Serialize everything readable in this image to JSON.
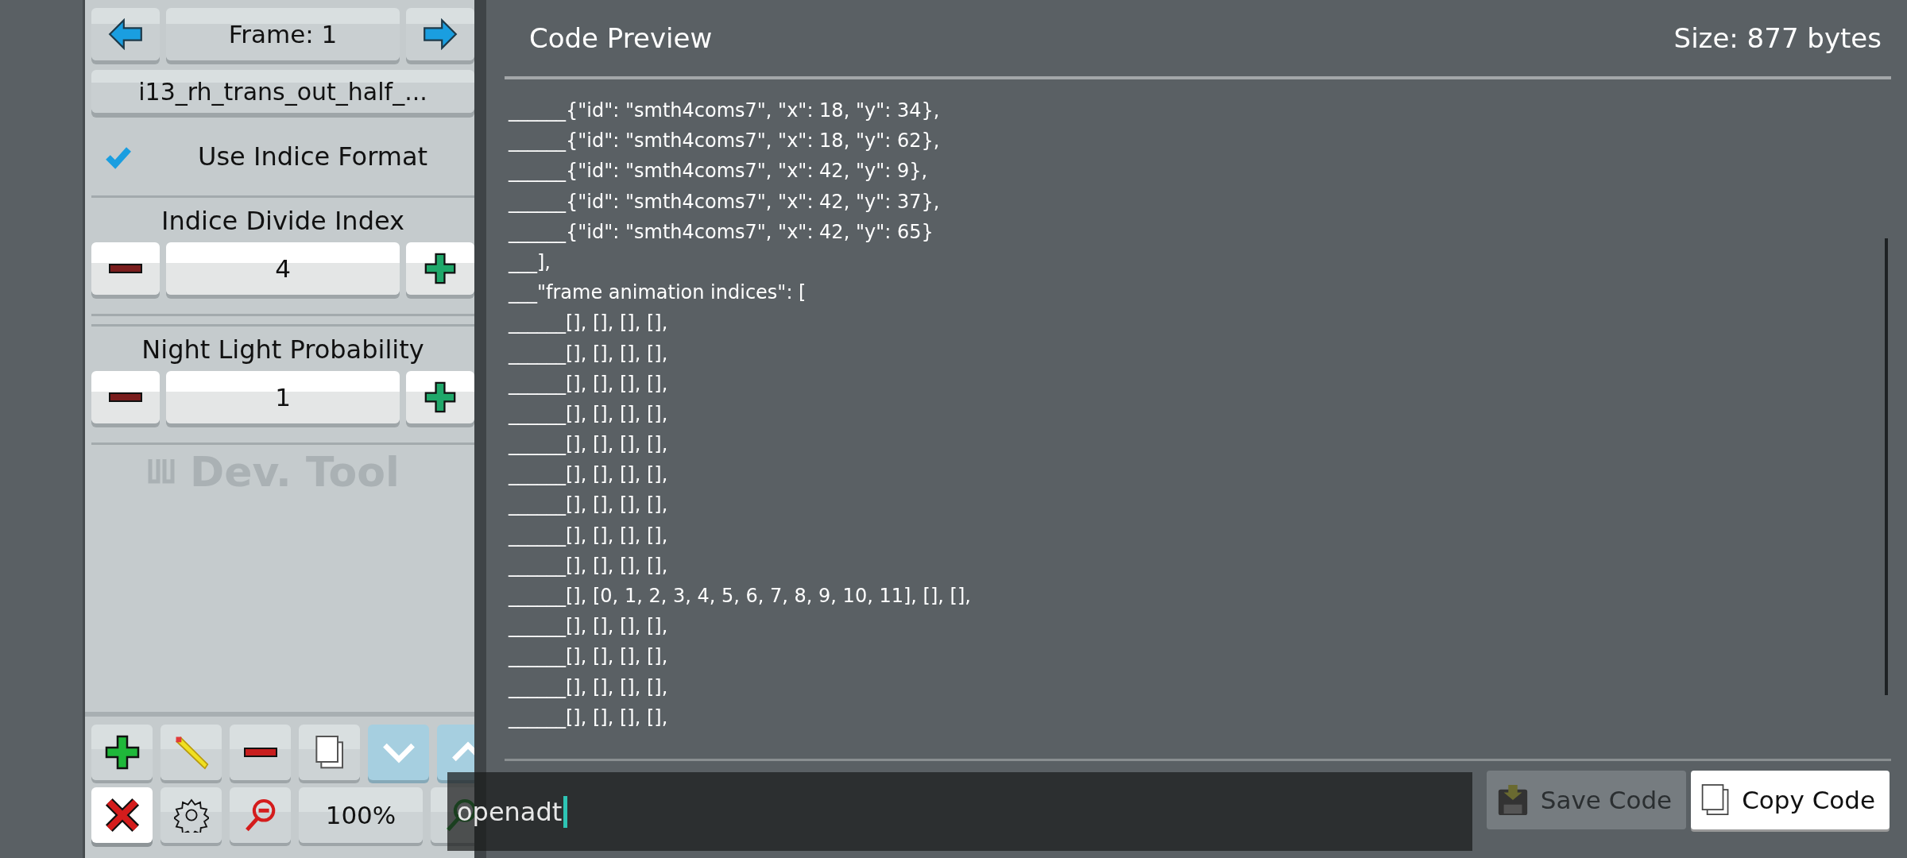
{
  "frame_nav": {
    "label": "Frame: 1"
  },
  "file_name": "i13_rh_trans_out_half_...",
  "use_indice_format": {
    "label": "Use Indice Format",
    "checked": true
  },
  "steppers": [
    {
      "label": "Indice Divide Index",
      "value": "4"
    },
    {
      "label": "Night Light Probability",
      "value": "1"
    }
  ],
  "logo": {
    "text": "Dev. Tool"
  },
  "toolbar": [
    [
      {
        "kind": "add",
        "selected": false
      },
      {
        "kind": "edit",
        "selected": false
      },
      {
        "kind": "remove",
        "selected": false
      },
      {
        "kind": "duplicate",
        "selected": false
      },
      {
        "kind": "move-down",
        "selected": false
      },
      {
        "kind": "move-up",
        "selected": false
      }
    ],
    [
      {
        "kind": "delete",
        "selected": true
      },
      {
        "kind": "settings",
        "selected": false
      },
      {
        "kind": "zoom-out",
        "selected": false
      },
      {
        "kind": "zoom-level",
        "text": "100%",
        "selected": false
      },
      {
        "kind": "zoom-in",
        "selected": false
      }
    ]
  ],
  "code_preview": {
    "title": "Code Preview",
    "size": "Size: 877 bytes",
    "lines": [
      "______{\"id\": \"smth4coms7\", \"x\": 18, \"y\": 34},",
      "______{\"id\": \"smth4coms7\", \"x\": 18, \"y\": 62},",
      "______{\"id\": \"smth4coms7\", \"x\": 42, \"y\": 9},",
      "______{\"id\": \"smth4coms7\", \"x\": 42, \"y\": 37},",
      "______{\"id\": \"smth4coms7\", \"x\": 42, \"y\": 65}",
      "___],",
      "___\"frame animation indices\": [",
      "______[], [], [], [],",
      "______[], [], [], [],",
      "______[], [], [], [],",
      "______[], [], [], [],",
      "______[], [], [], [],",
      "______[], [], [], [],",
      "______[], [], [], [],",
      "______[], [], [], [],",
      "______[], [], [], [],",
      "______[], [0, 1, 2, 3, 4, 5, 6, 7, 8, 9, 10, 11], [], [],",
      "______[], [], [], [],",
      "______[], [], [], [],",
      "______[], [], [], [],",
      "______[], [], [], [],"
    ]
  },
  "buttons": [
    {
      "kind": "save",
      "label": "Save Code",
      "disabled": true
    },
    {
      "kind": "copy",
      "label": "Copy Code",
      "disabled": false
    }
  ],
  "console": {
    "value": "openadt"
  }
}
